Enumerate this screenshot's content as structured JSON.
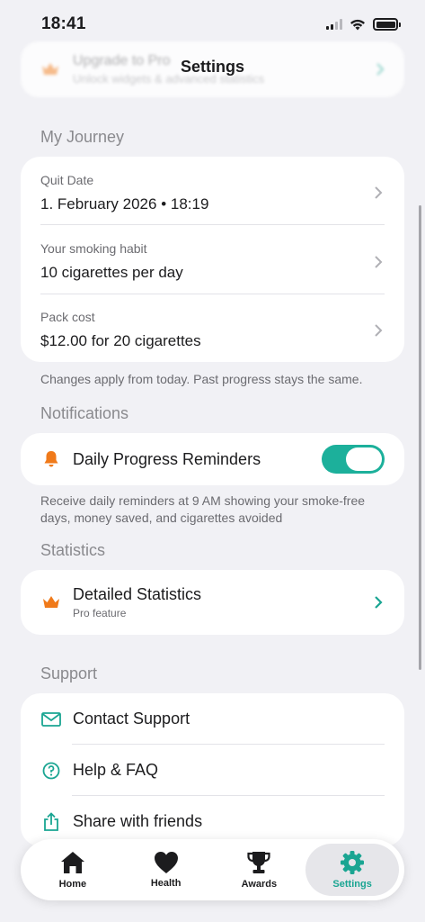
{
  "status_bar": {
    "time": "18:41"
  },
  "nav": {
    "title": "Settings"
  },
  "pro_banner": {
    "title": "Upgrade to Pro",
    "subtitle": "Unlock widgets & advanced statistics"
  },
  "journey": {
    "header": "My Journey",
    "quit_date": {
      "label": "Quit Date",
      "value": "1. February 2026 • 18:19"
    },
    "habit": {
      "label": "Your smoking habit",
      "value": "10 cigarettes per day"
    },
    "pack_cost": {
      "label": "Pack cost",
      "value": "$12.00 for 20 cigarettes"
    },
    "footnote": "Changes apply from today. Past progress stays the same."
  },
  "notifications": {
    "header": "Notifications",
    "reminders_label": "Daily Progress Reminders",
    "reminders_on": true,
    "footnote": "Receive daily reminders at 9 AM showing your smoke-free days, money saved, and cigarettes avoided"
  },
  "statistics": {
    "header": "Statistics",
    "detailed_label": "Detailed Statistics",
    "detailed_sub": "Pro feature"
  },
  "support": {
    "header": "Support",
    "items": [
      {
        "label": "Contact Support",
        "icon": "envelope-icon"
      },
      {
        "label": "Help & FAQ",
        "icon": "question-icon"
      },
      {
        "label": "Share with friends",
        "icon": "share-icon"
      }
    ]
  },
  "tabs": [
    {
      "label": "Home",
      "icon": "house-icon",
      "active": false
    },
    {
      "label": "Health",
      "icon": "heart-icon",
      "active": false
    },
    {
      "label": "Awards",
      "icon": "trophy-icon",
      "active": false
    },
    {
      "label": "Settings",
      "icon": "gear-icon",
      "active": true
    }
  ],
  "colors": {
    "accent": "#1cb09b",
    "orange": "#f07a1a",
    "background": "#f1f1f5"
  }
}
